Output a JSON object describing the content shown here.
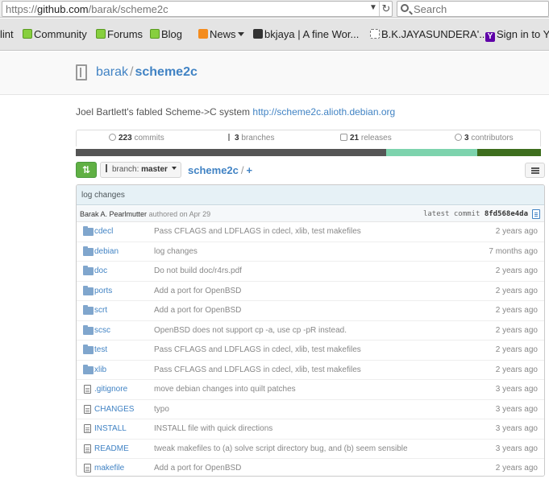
{
  "browser": {
    "url_prefix": "https://",
    "url_host": "github.com",
    "url_path": "/barak/scheme2c",
    "search_placeholder": "Search"
  },
  "bookmarks": [
    {
      "label": "lint",
      "icon": "none"
    },
    {
      "label": "Community",
      "icon": "mint-icon"
    },
    {
      "label": "Forums",
      "icon": "mint-icon"
    },
    {
      "label": "Blog",
      "icon": "mint-icon"
    },
    {
      "label": "News",
      "icon": "rss-icon"
    },
    {
      "label": "bkjaya | A fine Wor...",
      "icon": "photo-icon"
    },
    {
      "label": "B.K.JAYASUNDERA'...",
      "icon": "blank-page-icon"
    },
    {
      "label": "Sign in to Y",
      "icon": "yahoo-icon"
    }
  ],
  "repo": {
    "owner": "barak",
    "separator": "/",
    "name": "scheme2c",
    "description": "Joel Bartlett's fabled Scheme->C system",
    "homepage": "http://scheme2c.alioth.debian.org"
  },
  "summary": {
    "commits_count": "223",
    "commits_label": "commits",
    "branches_count": "3",
    "branches_label": "branches",
    "releases_count": "21",
    "releases_label": "releases",
    "contributors_count": "3",
    "contributors_label": "contributors"
  },
  "language_bar": [
    {
      "fraction": 0.668,
      "color": "#555555"
    },
    {
      "fraction": 0.195,
      "color": "#7dd3ad"
    },
    {
      "fraction": 0.137,
      "color": "#3e6e1e"
    }
  ],
  "nav": {
    "branch_prefix": "branch:",
    "branch_name": "master",
    "crumb_root": "scheme2c",
    "crumb_sep": "/",
    "crumb_add": "+"
  },
  "commit": {
    "message": "log changes",
    "author": "Barak A. Pearlmutter",
    "authored": "authored on Apr 29",
    "latest_label": "latest commit",
    "sha": "8fd568e4da"
  },
  "files": [
    {
      "type": "dir",
      "name": "cdecl",
      "message": "Pass CFLAGS and LDFLAGS in cdecl, xlib, test makefiles",
      "age": "2 years ago"
    },
    {
      "type": "dir",
      "name": "debian",
      "message": "log changes",
      "age": "7 months ago"
    },
    {
      "type": "dir",
      "name": "doc",
      "message": "Do not build doc/r4rs.pdf",
      "age": "2 years ago"
    },
    {
      "type": "dir",
      "name": "ports",
      "message": "Add a port for OpenBSD",
      "age": "2 years ago"
    },
    {
      "type": "dir",
      "name": "scrt",
      "message": "Add a port for OpenBSD",
      "age": "2 years ago"
    },
    {
      "type": "dir",
      "name": "scsc",
      "message": "OpenBSD does not support cp -a, use cp -pR instead.",
      "age": "2 years ago"
    },
    {
      "type": "dir",
      "name": "test",
      "message": "Pass CFLAGS and LDFLAGS in cdecl, xlib, test makefiles",
      "age": "2 years ago"
    },
    {
      "type": "dir",
      "name": "xlib",
      "message": "Pass CFLAGS and LDFLAGS in cdecl, xlib, test makefiles",
      "age": "2 years ago"
    },
    {
      "type": "file",
      "name": ".gitignore",
      "message": "move debian changes into quilt patches",
      "age": "3 years ago"
    },
    {
      "type": "file",
      "name": "CHANGES",
      "message": "typo",
      "age": "3 years ago"
    },
    {
      "type": "file",
      "name": "INSTALL",
      "message": "INSTALL file with quick directions",
      "age": "3 years ago"
    },
    {
      "type": "file",
      "name": "README",
      "message": "tweak makefiles to (a) solve script directory bug, and (b) seem sensible",
      "age": "3 years ago"
    },
    {
      "type": "file",
      "name": "makefile",
      "message": "Add a port for OpenBSD",
      "age": "2 years ago"
    }
  ]
}
